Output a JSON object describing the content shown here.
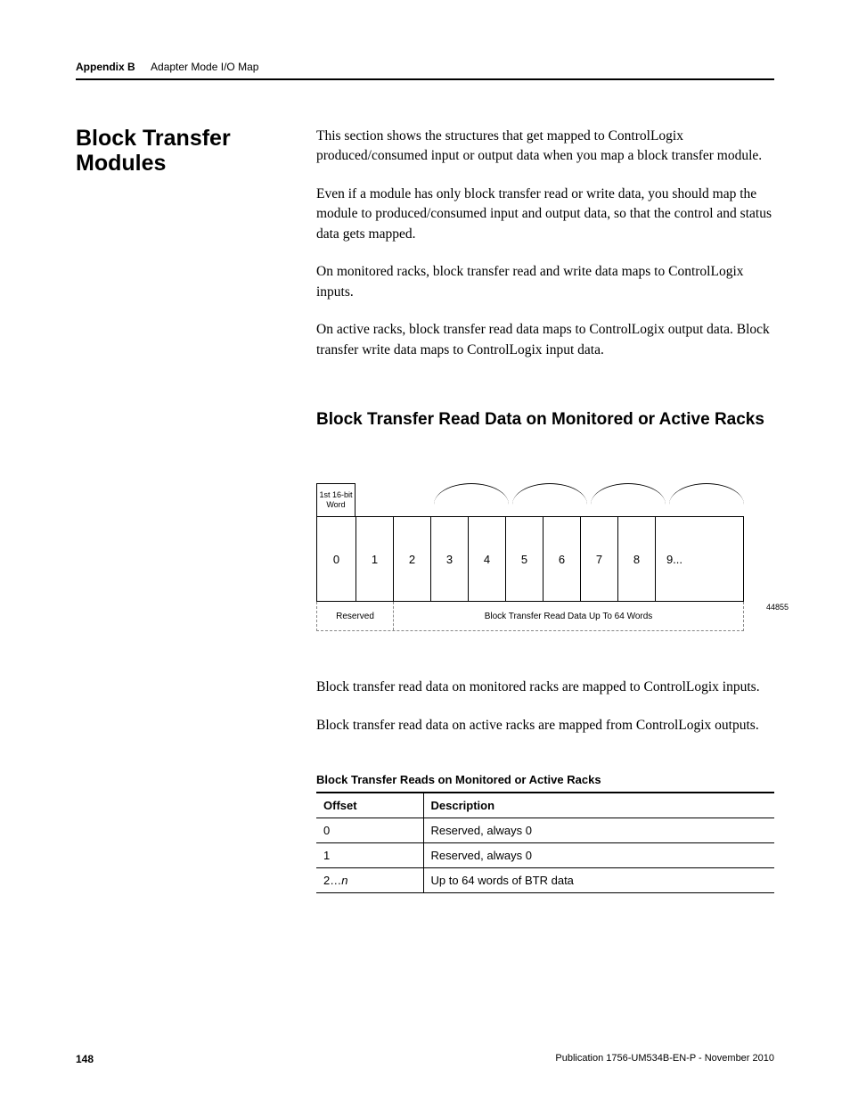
{
  "header": {
    "appendix": "Appendix B",
    "subtitle": "Adapter Mode I/O Map"
  },
  "section": {
    "title": "Block Transfer Modules",
    "p1": "This section shows the structures that get mapped to ControlLogix produced/consumed input or output data when you map a block transfer module.",
    "p2": "Even if a module has only block transfer read or write data, you should map the module to produced/consumed input and output data, so that the control and status data gets mapped.",
    "p3": "On monitored racks, block transfer read and write data maps to ControlLogix inputs.",
    "p4": "On active racks, block transfer read data maps to ControlLogix output data. Block transfer write data maps to ControlLogix input data.",
    "h2": "Block Transfer Read Data on Monitored or Active Racks"
  },
  "diagram": {
    "wordbox": "1st 16-bit Word",
    "cells": [
      "0",
      "1",
      "2",
      "3",
      "4",
      "5",
      "6",
      "7",
      "8",
      "9..."
    ],
    "reserved": "Reserved",
    "btr": "Block Transfer Read Data Up To 64 Words",
    "figid": "44855"
  },
  "after_diagram": {
    "p1": "Block transfer read data on monitored racks are mapped to ControlLogix inputs.",
    "p2": "Block transfer read data on active racks are mapped from ControlLogix outputs."
  },
  "table": {
    "title": "Block Transfer Reads on Monitored or Active Racks",
    "headers": {
      "offset": "Offset",
      "desc": "Description"
    },
    "rows": [
      {
        "offset": "0",
        "desc": "Reserved, always 0"
      },
      {
        "offset": "1",
        "desc": "Reserved, always 0"
      },
      {
        "offset_prefix": "2…",
        "offset_suffix": "n",
        "desc": "Up to 64 words of BTR data"
      }
    ]
  },
  "footer": {
    "page": "148",
    "pub": "Publication 1756-UM534B-EN-P - November 2010"
  }
}
